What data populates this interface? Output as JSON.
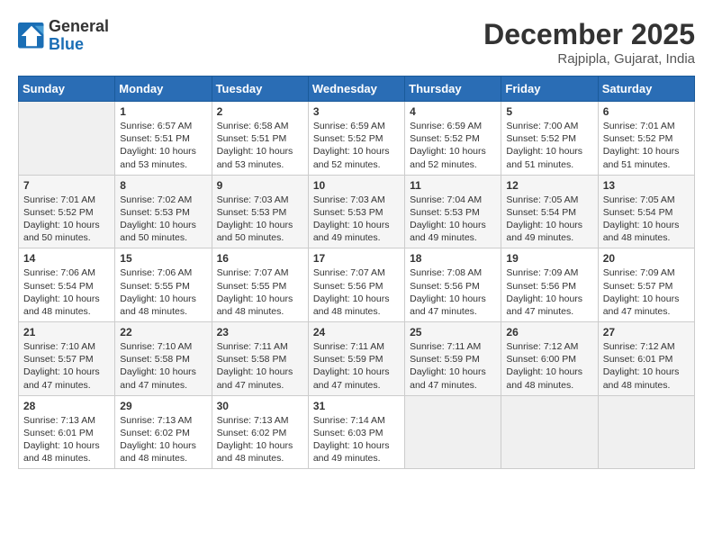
{
  "header": {
    "logo_line1": "General",
    "logo_line2": "Blue",
    "month_year": "December 2025",
    "location": "Rajpipla, Gujarat, India"
  },
  "days_of_week": [
    "Sunday",
    "Monday",
    "Tuesday",
    "Wednesday",
    "Thursday",
    "Friday",
    "Saturday"
  ],
  "weeks": [
    [
      {
        "day": "",
        "content": ""
      },
      {
        "day": "1",
        "content": "Sunrise: 6:57 AM\nSunset: 5:51 PM\nDaylight: 10 hours\nand 53 minutes."
      },
      {
        "day": "2",
        "content": "Sunrise: 6:58 AM\nSunset: 5:51 PM\nDaylight: 10 hours\nand 53 minutes."
      },
      {
        "day": "3",
        "content": "Sunrise: 6:59 AM\nSunset: 5:52 PM\nDaylight: 10 hours\nand 52 minutes."
      },
      {
        "day": "4",
        "content": "Sunrise: 6:59 AM\nSunset: 5:52 PM\nDaylight: 10 hours\nand 52 minutes."
      },
      {
        "day": "5",
        "content": "Sunrise: 7:00 AM\nSunset: 5:52 PM\nDaylight: 10 hours\nand 51 minutes."
      },
      {
        "day": "6",
        "content": "Sunrise: 7:01 AM\nSunset: 5:52 PM\nDaylight: 10 hours\nand 51 minutes."
      }
    ],
    [
      {
        "day": "7",
        "content": "Sunrise: 7:01 AM\nSunset: 5:52 PM\nDaylight: 10 hours\nand 50 minutes."
      },
      {
        "day": "8",
        "content": "Sunrise: 7:02 AM\nSunset: 5:53 PM\nDaylight: 10 hours\nand 50 minutes."
      },
      {
        "day": "9",
        "content": "Sunrise: 7:03 AM\nSunset: 5:53 PM\nDaylight: 10 hours\nand 50 minutes."
      },
      {
        "day": "10",
        "content": "Sunrise: 7:03 AM\nSunset: 5:53 PM\nDaylight: 10 hours\nand 49 minutes."
      },
      {
        "day": "11",
        "content": "Sunrise: 7:04 AM\nSunset: 5:53 PM\nDaylight: 10 hours\nand 49 minutes."
      },
      {
        "day": "12",
        "content": "Sunrise: 7:05 AM\nSunset: 5:54 PM\nDaylight: 10 hours\nand 49 minutes."
      },
      {
        "day": "13",
        "content": "Sunrise: 7:05 AM\nSunset: 5:54 PM\nDaylight: 10 hours\nand 48 minutes."
      }
    ],
    [
      {
        "day": "14",
        "content": "Sunrise: 7:06 AM\nSunset: 5:54 PM\nDaylight: 10 hours\nand 48 minutes."
      },
      {
        "day": "15",
        "content": "Sunrise: 7:06 AM\nSunset: 5:55 PM\nDaylight: 10 hours\nand 48 minutes."
      },
      {
        "day": "16",
        "content": "Sunrise: 7:07 AM\nSunset: 5:55 PM\nDaylight: 10 hours\nand 48 minutes."
      },
      {
        "day": "17",
        "content": "Sunrise: 7:07 AM\nSunset: 5:56 PM\nDaylight: 10 hours\nand 48 minutes."
      },
      {
        "day": "18",
        "content": "Sunrise: 7:08 AM\nSunset: 5:56 PM\nDaylight: 10 hours\nand 47 minutes."
      },
      {
        "day": "19",
        "content": "Sunrise: 7:09 AM\nSunset: 5:56 PM\nDaylight: 10 hours\nand 47 minutes."
      },
      {
        "day": "20",
        "content": "Sunrise: 7:09 AM\nSunset: 5:57 PM\nDaylight: 10 hours\nand 47 minutes."
      }
    ],
    [
      {
        "day": "21",
        "content": "Sunrise: 7:10 AM\nSunset: 5:57 PM\nDaylight: 10 hours\nand 47 minutes."
      },
      {
        "day": "22",
        "content": "Sunrise: 7:10 AM\nSunset: 5:58 PM\nDaylight: 10 hours\nand 47 minutes."
      },
      {
        "day": "23",
        "content": "Sunrise: 7:11 AM\nSunset: 5:58 PM\nDaylight: 10 hours\nand 47 minutes."
      },
      {
        "day": "24",
        "content": "Sunrise: 7:11 AM\nSunset: 5:59 PM\nDaylight: 10 hours\nand 47 minutes."
      },
      {
        "day": "25",
        "content": "Sunrise: 7:11 AM\nSunset: 5:59 PM\nDaylight: 10 hours\nand 47 minutes."
      },
      {
        "day": "26",
        "content": "Sunrise: 7:12 AM\nSunset: 6:00 PM\nDaylight: 10 hours\nand 48 minutes."
      },
      {
        "day": "27",
        "content": "Sunrise: 7:12 AM\nSunset: 6:01 PM\nDaylight: 10 hours\nand 48 minutes."
      }
    ],
    [
      {
        "day": "28",
        "content": "Sunrise: 7:13 AM\nSunset: 6:01 PM\nDaylight: 10 hours\nand 48 minutes."
      },
      {
        "day": "29",
        "content": "Sunrise: 7:13 AM\nSunset: 6:02 PM\nDaylight: 10 hours\nand 48 minutes."
      },
      {
        "day": "30",
        "content": "Sunrise: 7:13 AM\nSunset: 6:02 PM\nDaylight: 10 hours\nand 48 minutes."
      },
      {
        "day": "31",
        "content": "Sunrise: 7:14 AM\nSunset: 6:03 PM\nDaylight: 10 hours\nand 49 minutes."
      },
      {
        "day": "",
        "content": ""
      },
      {
        "day": "",
        "content": ""
      },
      {
        "day": "",
        "content": ""
      }
    ]
  ]
}
